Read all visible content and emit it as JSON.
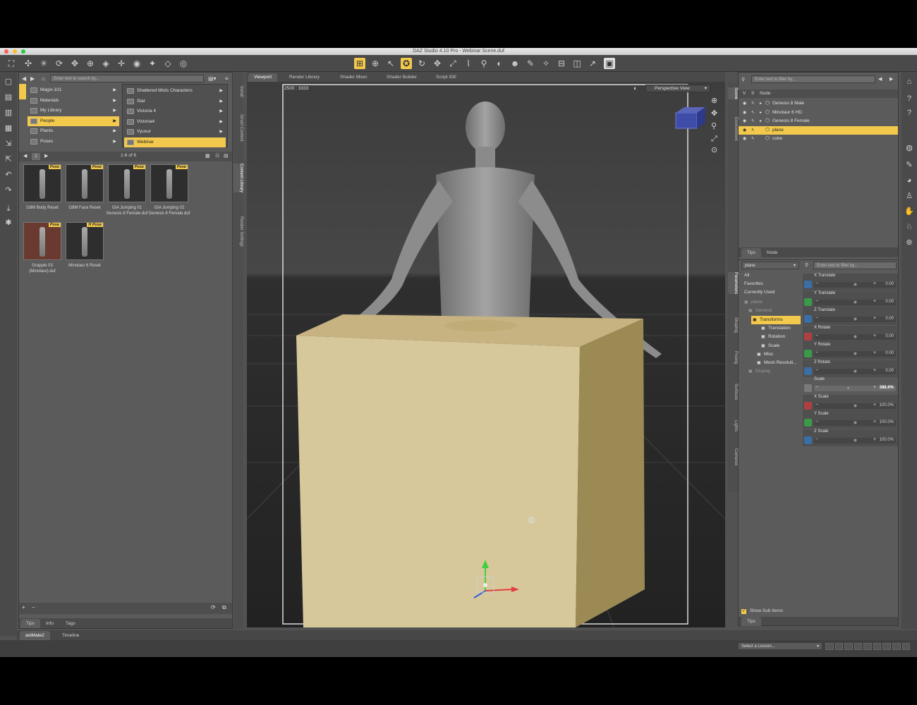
{
  "window": {
    "title": "DAZ Studio 4.10 Pro - Webinar Scene.duf"
  },
  "toolbar": {
    "icons": [
      "pointer-icon",
      "universal-tool-icon",
      "rotate-tool-icon",
      "translate-tool-icon",
      "scale-tool-icon",
      "node-weight-icon",
      "geometry-editor-icon",
      "camera-icon"
    ]
  },
  "content_library": {
    "search_placeholder": "Enter text to search by...",
    "folders_col1": [
      "Magix-101",
      "Materials",
      "My Library",
      "People",
      "Plants",
      "Poses"
    ],
    "folders_col2": [
      "Shattered Mists Characters",
      "Star",
      "Victoria 4",
      "Victoria4",
      "Vyusur",
      "Webinar"
    ],
    "selected_col1": "People",
    "selected_col2": "Webinar",
    "page_number": "1",
    "page_range": "1-6 of 6",
    "items": [
      {
        "label": "G8M Body Reset",
        "badge": "Pose"
      },
      {
        "label": "G8M Face Reset",
        "badge": "Pose"
      },
      {
        "label": "GiA Jumping 01 Genesis 8 Female.duf",
        "badge": "Pose"
      },
      {
        "label": "GiA Jumping 02 Genesis 8 Female.duf",
        "badge": "Pose"
      },
      {
        "label": "Grapple 03 (Minotaur).duf",
        "badge": "Pose"
      },
      {
        "label": "Minotaur 6 Reset",
        "badge": "H Pose"
      }
    ],
    "bottom_tabs": [
      "Tips",
      "Info",
      "Tags"
    ],
    "side_tabs": [
      "Install",
      "Smart Content",
      "Content Library",
      "Render Settings"
    ]
  },
  "viewport": {
    "tabs": [
      "Viewport",
      "Render Library",
      "Shader Mixer",
      "Shader Builder",
      "Script IDE"
    ],
    "active_tab": "Viewport",
    "resolution": "2500 : 3333",
    "view_mode": "Perspective View"
  },
  "scene": {
    "filter_placeholder": "Enter text to filter by...",
    "columns": [
      "V",
      "S",
      "Node"
    ],
    "nodes": [
      "Genesis 8 Male",
      "Minotaur 6 HD",
      "Genesis 8 Female",
      "plane",
      "cube"
    ],
    "selected_node": "plane",
    "side_tabs": [
      "Scene",
      "Environment"
    ],
    "bottom_tabs": [
      "Tips",
      "Node"
    ]
  },
  "parameters": {
    "node_select": "plane",
    "filter_placeholder": "Enter text to filter by...",
    "categories": [
      "All",
      "Favorites",
      "Currently Used"
    ],
    "tree": [
      "plane",
      "General",
      "Transforms",
      "Translation",
      "Rotation",
      "Scale",
      "Misc",
      "Mesh Resoluti...",
      "Display"
    ],
    "selected_tree": "Transforms",
    "show_sub_items": "Show Sub Items",
    "side_tabs": [
      "Parameters",
      "Shaping",
      "Posing",
      "Surfaces",
      "Lights",
      "Cameras"
    ],
    "bottom_tab": "Tips",
    "props": [
      {
        "name": "X Translate",
        "value": "0.00",
        "level": 0.5,
        "color": "#3a6ea5"
      },
      {
        "name": "Y Translate",
        "value": "0.00",
        "level": 0.5,
        "color": "#3a9a4a"
      },
      {
        "name": "Z Translate",
        "value": "0.00",
        "level": 0.5,
        "color": "#3a6ea5"
      },
      {
        "name": "X Rotate",
        "value": "0.00",
        "level": 0.5,
        "color": "#b04040"
      },
      {
        "name": "Y Rotate",
        "value": "0.00",
        "level": 0.5,
        "color": "#3a9a4a"
      },
      {
        "name": "Z Rotate",
        "value": "0.00",
        "level": 0.5,
        "color": "#3a6ea5"
      },
      {
        "name": "Scale",
        "value": "388.6%",
        "level": 0.96,
        "color": "#7a7a7a"
      },
      {
        "name": "X Scale",
        "value": "100.0%",
        "level": 0.5,
        "color": "#b04040"
      },
      {
        "name": "Y Scale",
        "value": "100.0%",
        "level": 0.5,
        "color": "#3a9a4a"
      },
      {
        "name": "Z Scale",
        "value": "100.0%",
        "level": 0.5,
        "color": "#3a6ea5"
      }
    ]
  },
  "bottom": {
    "tabs": [
      "aniMate2",
      "Timeline"
    ],
    "lesson_placeholder": "Select a Lesson..."
  },
  "colors": {
    "accent": "#f2c94c",
    "panel": "#5b5b5b",
    "viewport_bg": "#3a3a3a",
    "cube": "#d7c89b"
  }
}
